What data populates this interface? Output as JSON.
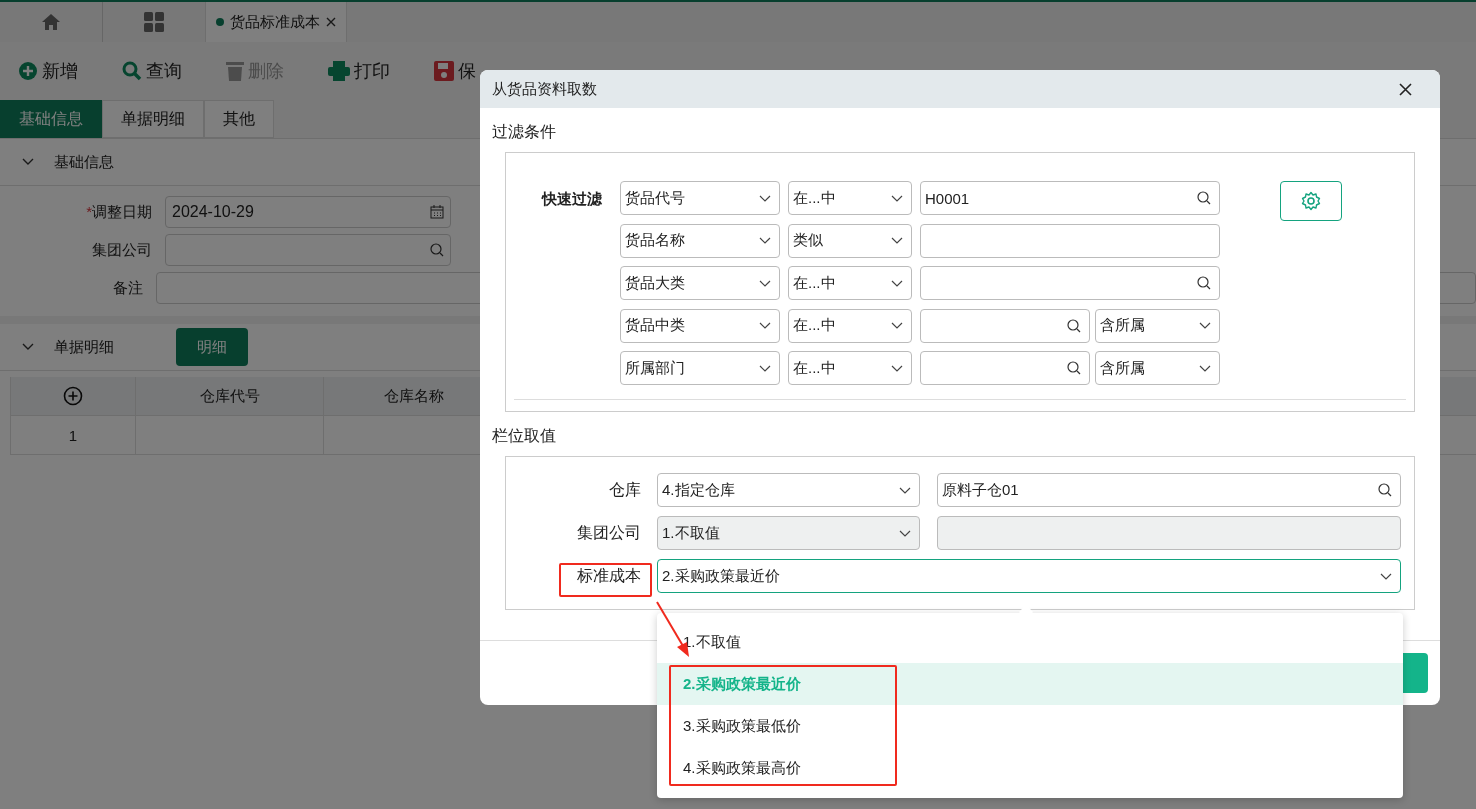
{
  "doc_tab": {
    "label": "货品标准成本"
  },
  "toolbar": [
    {
      "label": "新增",
      "kind": "add",
      "disabled": false,
      "dropdown": false
    },
    {
      "label": "查询",
      "kind": "search",
      "disabled": false,
      "dropdown": false
    },
    {
      "label": "删除",
      "kind": "delete",
      "disabled": true,
      "dropdown": false
    },
    {
      "label": "打印",
      "kind": "print",
      "disabled": false,
      "dropdown": false
    },
    {
      "label": "保",
      "kind": "save",
      "disabled": false,
      "dropdown": false
    }
  ],
  "form_tabs": [
    {
      "label": "基础信息",
      "selected": true
    },
    {
      "label": "单据明细",
      "selected": false
    },
    {
      "label": "其他",
      "selected": false
    }
  ],
  "basic": {
    "title": "基础信息",
    "fields": [
      {
        "label": "调整日期",
        "required_mark": "*",
        "value": "2024-10-29",
        "kind": "date"
      },
      {
        "label": "集团公司",
        "kind": "lookup"
      },
      {
        "label": "备注",
        "kind": "text"
      }
    ]
  },
  "detail": {
    "title": "单据明细",
    "button": "明细",
    "columns": [
      "仓库代号",
      "仓库名称"
    ],
    "rows": [
      [
        "1",
        "",
        ""
      ]
    ]
  },
  "dialog": {
    "title": "从货品资料取数",
    "filter_title": "过滤条件",
    "quick_filter": "快速过滤",
    "filters": [
      {
        "field": "货品代号",
        "operator": "在...中",
        "value": "H0001",
        "search": true
      },
      {
        "field": "货品名称",
        "operator": "类似",
        "search": false
      },
      {
        "field": "货品大类",
        "operator": "在...中",
        "search": true
      },
      {
        "field": "货品中类",
        "operator": "在...中",
        "search": true,
        "scope": "含所属"
      },
      {
        "field": "所属部门",
        "operator": "在...中",
        "search": true,
        "scope": "含所属"
      }
    ],
    "values_title": "栏位取值",
    "value_rows": [
      {
        "label": "仓库",
        "kind": "pair",
        "option": "4.指定仓库",
        "value": "原料子仓01",
        "disabled": false
      },
      {
        "label": "集团公司",
        "kind": "pair",
        "option": "1.不取值",
        "disabled": true
      },
      {
        "label": "标准成本",
        "kind": "single",
        "option": "2.采购政策最近价",
        "disabled": false
      }
    ],
    "dropdown": [
      {
        "label": "1.不取值",
        "selected": false
      },
      {
        "label": "2.采购政策最近价",
        "selected": true
      },
      {
        "label": "3.采购政策最低价",
        "selected": false
      },
      {
        "label": "4.采购政策最高价",
        "selected": false
      }
    ]
  }
}
